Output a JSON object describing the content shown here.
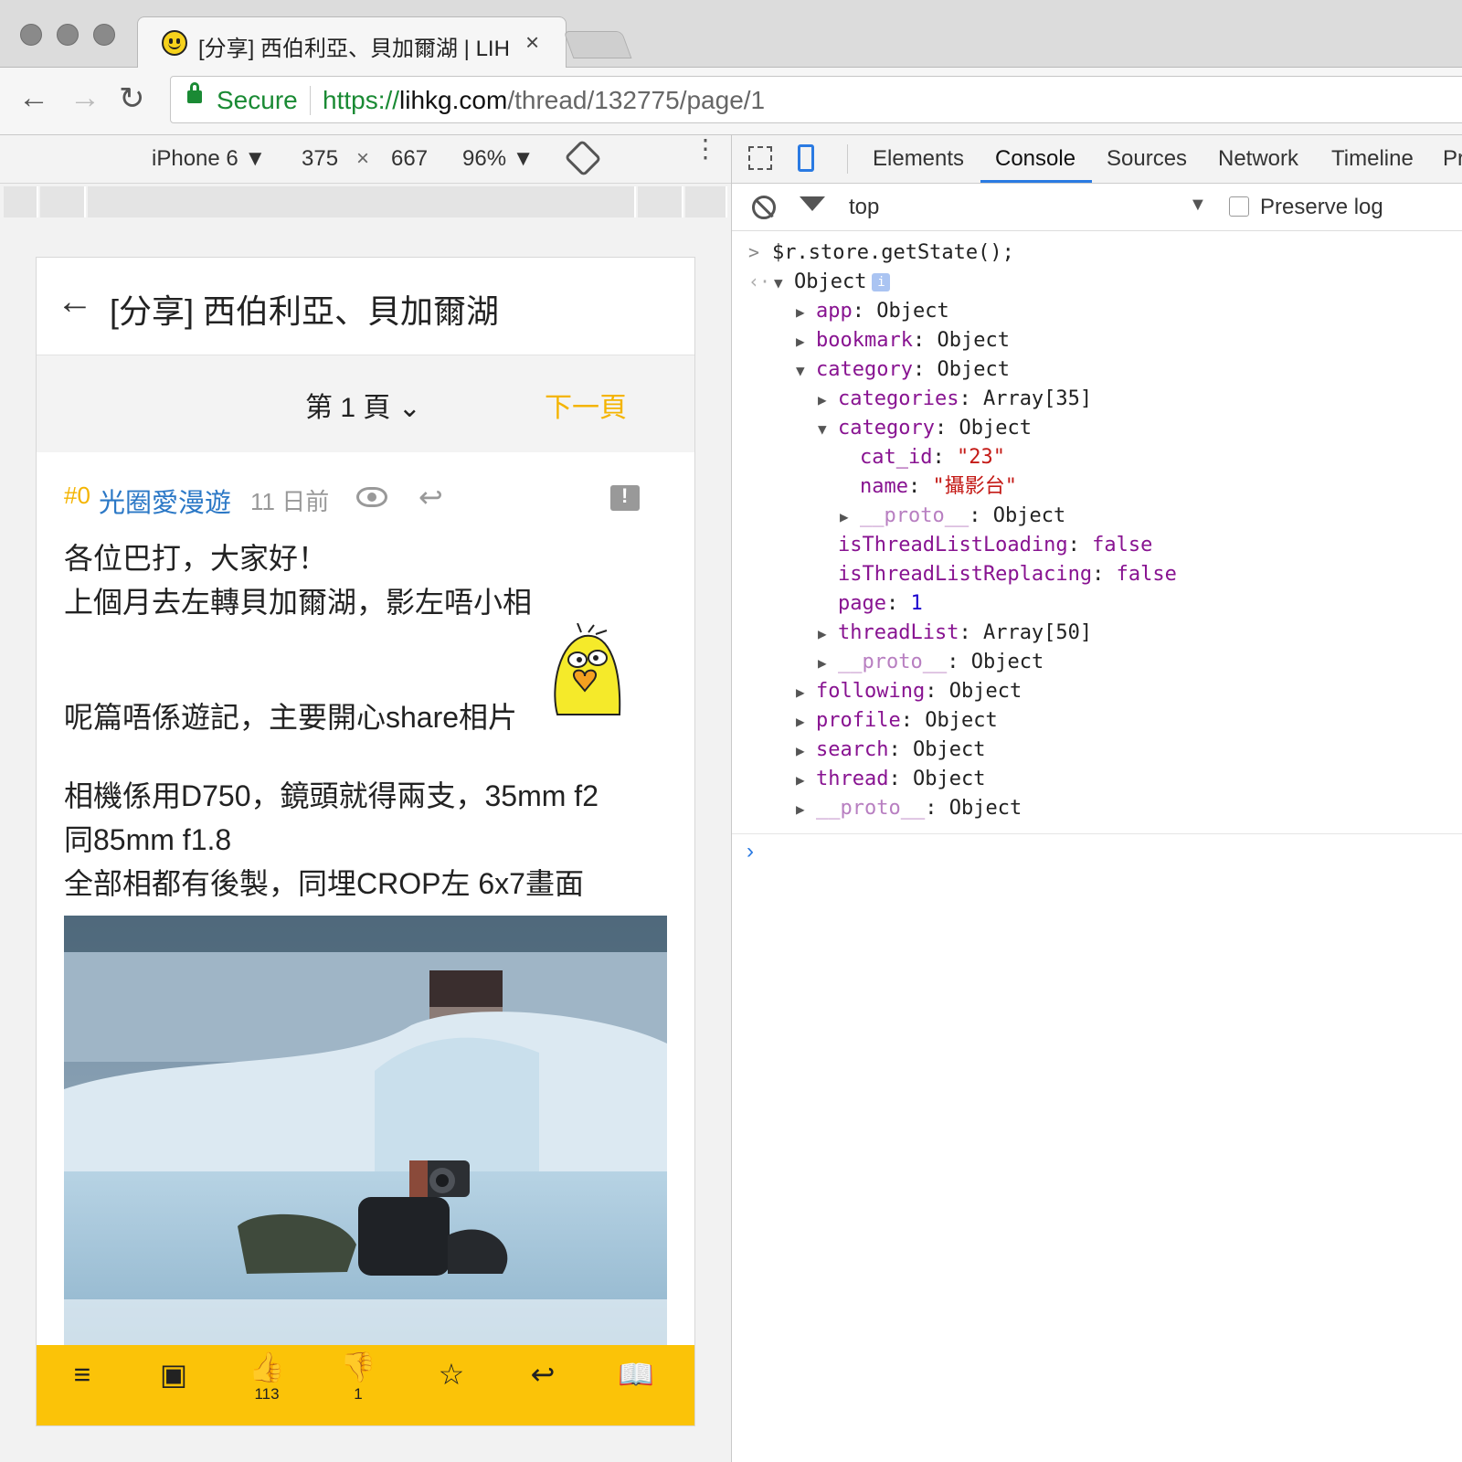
{
  "browser": {
    "tab_title": "[分享] 西伯利亞、貝加爾湖 | LIH",
    "tab_close": "×",
    "nav": {
      "back": "←",
      "forward": "→",
      "reload": "↻"
    },
    "secure_label": "Secure",
    "url_scheme": "https://",
    "url_host": "lihkg.com",
    "url_path": "/thread/132775/page/1"
  },
  "device_toolbar": {
    "device": "iPhone 6 ▼",
    "width": "375",
    "times": "×",
    "height": "667",
    "zoom": "96% ▼",
    "more": "⋮"
  },
  "thread": {
    "back": "←",
    "title": "[分享] 西伯利亞、貝加爾湖",
    "page_label": "第 1 頁 ⌄",
    "next_page": "下一頁",
    "post": {
      "number": "#0",
      "username": "光圈愛漫遊",
      "time": "11 日前",
      "reply_glyph": "↩",
      "body_lines": [
        "各位巴打，大家好！",
        "上個月去左轉貝加爾湖，影左唔小相",
        "",
        "呢篇唔係遊記，主要開心share相片",
        "",
        "相機係用D750，鏡頭就得兩支，35mm f2",
        "同85mm f1.8",
        "全部相都有後製，同埋CROP左 6x7畫面"
      ]
    },
    "bottom_bar": {
      "menu_glyph": "≡",
      "gallery_glyph": "▣",
      "like_glyph": "👍",
      "like_count": "113",
      "dislike_glyph": "👎",
      "dislike_count": "1",
      "star_glyph": "☆",
      "reply_glyph": "↩",
      "book_glyph": "📖"
    }
  },
  "devtools": {
    "tabs": [
      "Elements",
      "Console",
      "Sources",
      "Network",
      "Timeline",
      "Pr"
    ],
    "active_tab": "Console",
    "context": "top",
    "context_arrow": "▼",
    "preserve_log": "Preserve log",
    "command": "$r.store.getState();",
    "tree": {
      "root": "Object",
      "info": "i",
      "app": [
        "app",
        "Object"
      ],
      "bookmark": [
        "bookmark",
        "Object"
      ],
      "category": [
        "category",
        "Object"
      ],
      "categories": [
        "categories",
        "Array[35]"
      ],
      "category_inner": [
        "category",
        "Object"
      ],
      "cat_id": [
        "cat_id",
        "\"23\""
      ],
      "name": [
        "name",
        "\"攝影台\""
      ],
      "proto_inner": [
        "__proto__",
        "Object"
      ],
      "isThreadListLoading": [
        "isThreadListLoading",
        "false"
      ],
      "isThreadListReplacing": [
        "isThreadListReplacing",
        "false"
      ],
      "page": [
        "page",
        "1"
      ],
      "threadList": [
        "threadList",
        "Array[50]"
      ],
      "proto_category": [
        "__proto__",
        "Object"
      ],
      "following": [
        "following",
        "Object"
      ],
      "profile": [
        "profile",
        "Object"
      ],
      "search": [
        "search",
        "Object"
      ],
      "thread": [
        "thread",
        "Object"
      ],
      "proto_root": [
        "__proto__",
        "Object"
      ]
    },
    "prompt": "›"
  },
  "colors": {
    "accent_yellow": "#fbc308",
    "link_blue": "#2b78c6",
    "secure_green": "#1a8a34",
    "devtools_blue": "#2a7ae2"
  }
}
